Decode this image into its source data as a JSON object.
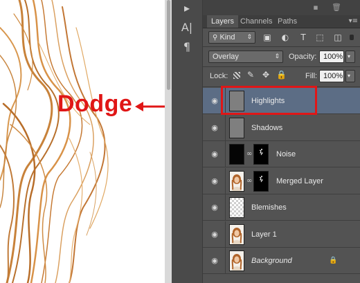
{
  "annotation": {
    "label": "Dodge",
    "color": "#e01616"
  },
  "toolstrip": {
    "icons": [
      "chat-bubble-icon",
      "character-icon",
      "paragraph-icon"
    ],
    "character_glyph": "A|",
    "paragraph_glyph": "¶"
  },
  "panel": {
    "tabs": [
      {
        "label": "Layers",
        "active": true
      },
      {
        "label": "Channels",
        "active": false
      },
      {
        "label": "Paths",
        "active": false
      }
    ],
    "filter": {
      "kind_label": "Kind",
      "icons": [
        "image-filter-icon",
        "adjustment-filter-icon",
        "type-filter-icon",
        "shape-filter-icon",
        "smart-object-filter-icon"
      ]
    },
    "blend_mode": "Overlay",
    "opacity_label": "Opacity:",
    "opacity_value": "100%",
    "lock_label": "Lock:",
    "fill_label": "Fill:",
    "fill_value": "100%",
    "layers": [
      {
        "name": "Highlights",
        "thumb": "gray",
        "mask": false,
        "selected": true,
        "italic": false,
        "locked": false
      },
      {
        "name": "Shadows",
        "thumb": "gray",
        "mask": false,
        "selected": false,
        "italic": false,
        "locked": false
      },
      {
        "name": "Noise",
        "thumb": "black",
        "mask": true,
        "selected": false,
        "italic": false,
        "locked": false
      },
      {
        "name": "Merged Layer",
        "thumb": "photo",
        "mask": true,
        "selected": false,
        "italic": false,
        "locked": false
      },
      {
        "name": "Blemishes",
        "thumb": "transparent",
        "mask": false,
        "selected": false,
        "italic": false,
        "locked": false
      },
      {
        "name": "Layer 1",
        "thumb": "photo",
        "mask": false,
        "selected": false,
        "italic": false,
        "locked": false
      },
      {
        "name": "Background",
        "thumb": "photo",
        "mask": false,
        "selected": false,
        "italic": true,
        "locked": true
      }
    ]
  }
}
